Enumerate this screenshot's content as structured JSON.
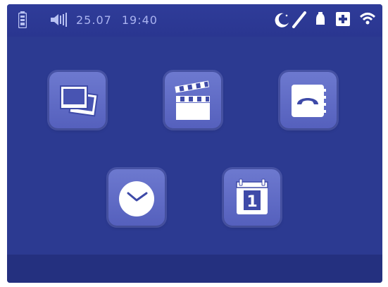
{
  "status_bar": {
    "date": "25.07",
    "time": "19:40",
    "icons": [
      "battery-icon",
      "speaker-icon",
      "moon-icon",
      "pen-icon",
      "bell-icon",
      "plus-box-icon",
      "wifi-icon"
    ]
  },
  "calendar": {
    "day": "1"
  },
  "colors": {
    "screen_bg": "#2c3a91",
    "tile_bg": "#6170c8",
    "icon_white": "#ffffff",
    "status_text": "#aab3f0"
  }
}
